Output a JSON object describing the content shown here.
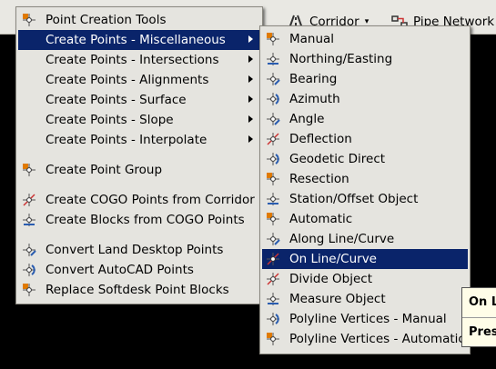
{
  "toolbar": {
    "corridor_label": "Corridor",
    "pipe_network_label": "Pipe Network"
  },
  "main_menu": {
    "items": [
      {
        "label": "Point Creation Tools",
        "icon": "point-tools-icon"
      },
      {
        "label": "Create Points - Miscellaneous",
        "submenu": true,
        "highlighted": true
      },
      {
        "label": "Create Points - Intersections",
        "submenu": true
      },
      {
        "label": "Create Points - Alignments",
        "submenu": true
      },
      {
        "label": "Create Points - Surface",
        "submenu": true
      },
      {
        "label": "Create Points - Slope",
        "submenu": true
      },
      {
        "label": "Create Points - Interpolate",
        "submenu": true
      },
      {
        "label": "Create Point Group",
        "icon": "point-group-icon"
      },
      {
        "label": "Create COGO Points from Corridor",
        "icon": "corridor-points-icon"
      },
      {
        "label": "Create Blocks from COGO Points",
        "icon": "blocks-icon"
      },
      {
        "label": "Convert Land Desktop Points",
        "icon": "convert-ld-icon"
      },
      {
        "label": "Convert AutoCAD Points",
        "icon": "convert-acad-icon"
      },
      {
        "label": "Replace Softdesk Point Blocks",
        "icon": "replace-blocks-icon"
      }
    ]
  },
  "submenu": {
    "items": [
      {
        "label": "Manual"
      },
      {
        "label": "Northing/Easting"
      },
      {
        "label": "Bearing"
      },
      {
        "label": "Azimuth"
      },
      {
        "label": "Angle"
      },
      {
        "label": "Deflection"
      },
      {
        "label": "Geodetic Direct"
      },
      {
        "label": "Resection"
      },
      {
        "label": "Station/Offset Object"
      },
      {
        "label": "Automatic"
      },
      {
        "label": "Along Line/Curve"
      },
      {
        "label": "On Line/Curve",
        "highlighted": true
      },
      {
        "label": "Divide Object"
      },
      {
        "label": "Measure Object"
      },
      {
        "label": "Polyline Vertices - Manual"
      },
      {
        "label": "Polyline Vertices - Automatic"
      }
    ]
  },
  "tooltip": {
    "title": "On L",
    "text": "Pres"
  },
  "colors": {
    "highlight": "#0a246a",
    "menu_bg": "#e5e4df",
    "icon_accent": "#e07a00",
    "icon_blue": "#2a5db0"
  }
}
